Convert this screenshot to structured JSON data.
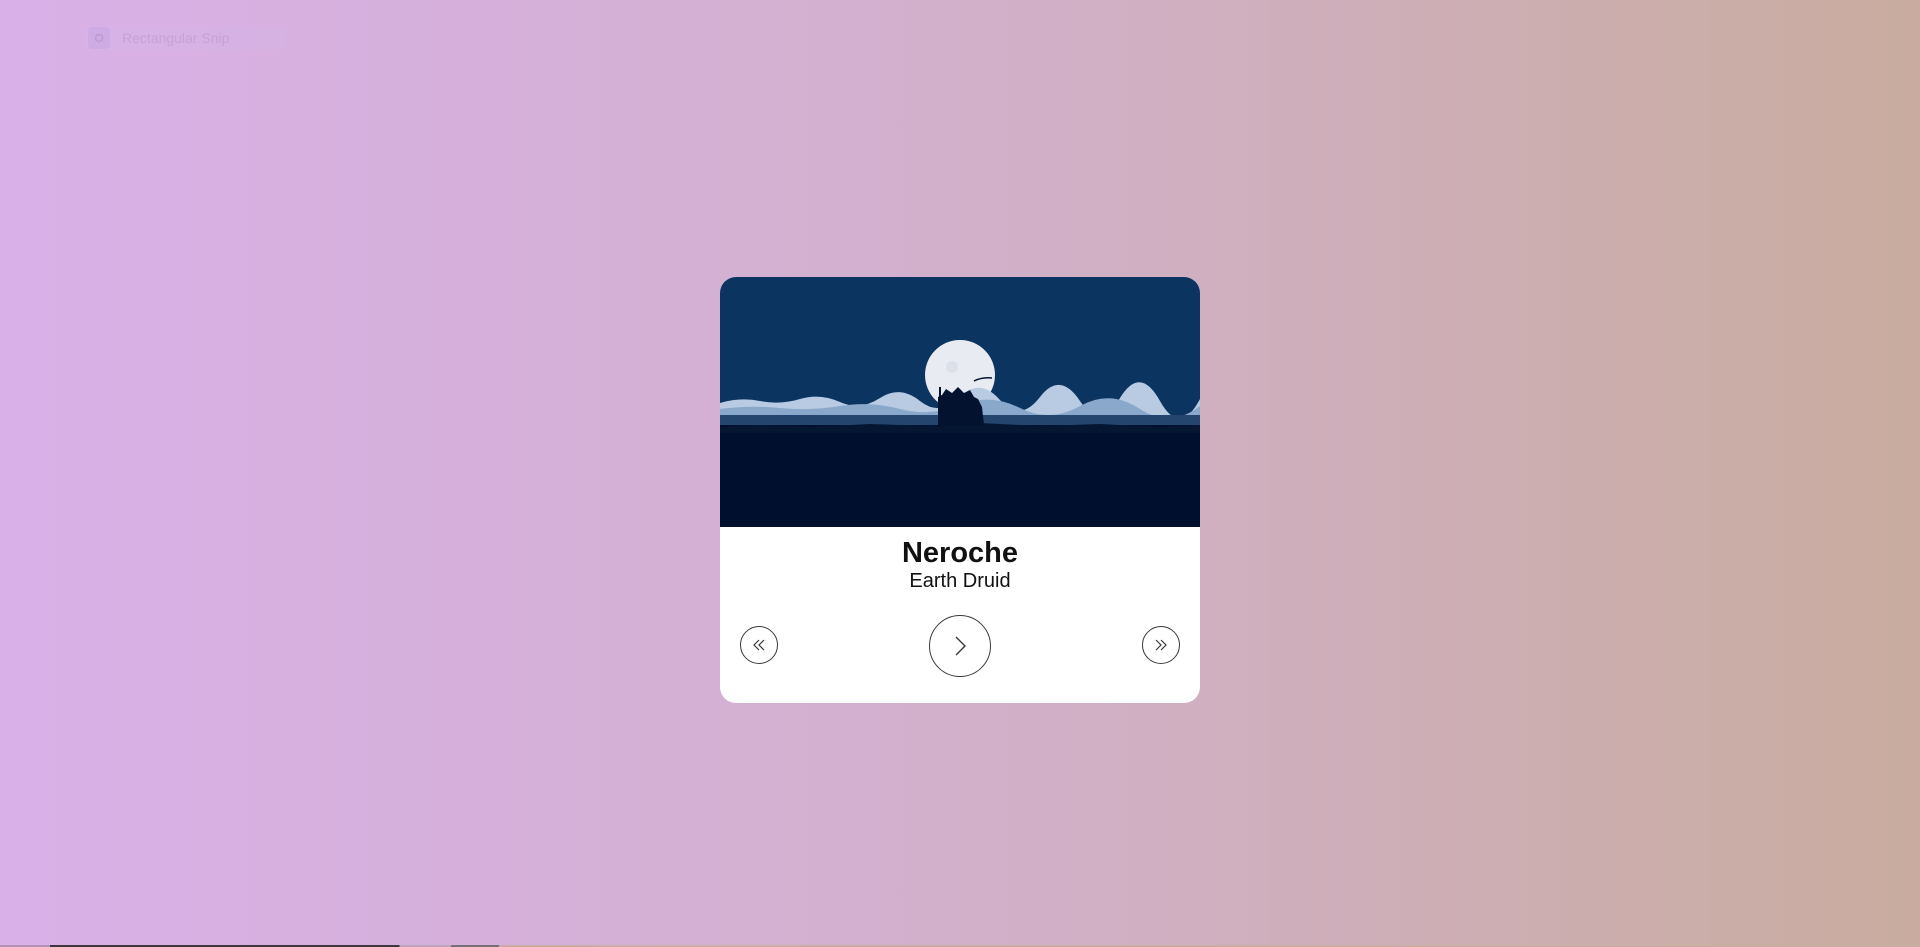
{
  "overlay": {
    "snip_label": "Rectangular Snip",
    "snip_icon": "snip-mode-icon"
  },
  "player": {
    "cover_icon": "moonlit-landscape-artwork",
    "title": "Neroche",
    "artist": "Earth Druid",
    "controls": {
      "prev_icon": "double-chevron-left-icon",
      "play_icon": "chevron-right-icon",
      "next_icon": "double-chevron-right-icon"
    }
  },
  "colors": {
    "background_start": "#d9b0e8",
    "background_end": "#c9ac9f",
    "card": "#ffffff",
    "sky": "#0b3461",
    "ground": "#000f2e",
    "text": "#111111"
  }
}
